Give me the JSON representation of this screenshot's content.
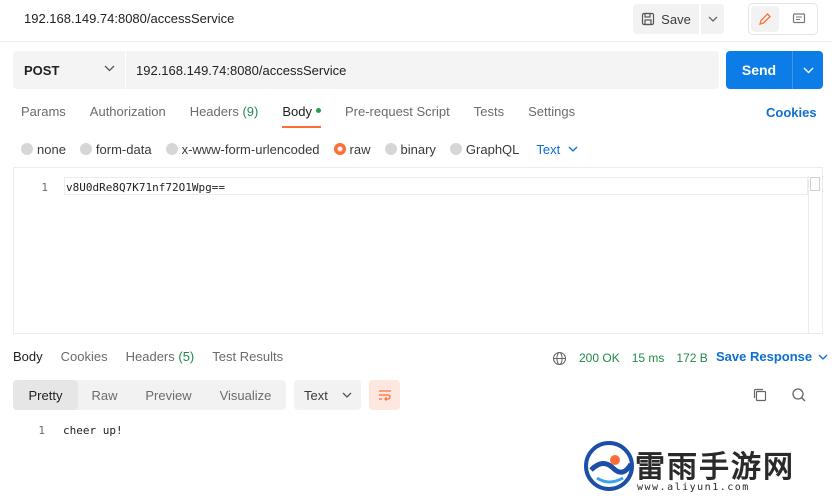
{
  "request": {
    "title": "192.168.149.74:8080/accessService",
    "save_label": "Save",
    "method": "POST",
    "url": "192.168.149.74:8080/accessService",
    "send_label": "Send"
  },
  "request_tabs": [
    {
      "label": "Params"
    },
    {
      "label": "Authorization"
    },
    {
      "label": "Headers",
      "count": "(9)"
    },
    {
      "label": "Body",
      "active": true
    },
    {
      "label": "Pre-request Script"
    },
    {
      "label": "Tests"
    },
    {
      "label": "Settings"
    }
  ],
  "cookies_label": "Cookies",
  "body_types": [
    {
      "label": "none"
    },
    {
      "label": "form-data"
    },
    {
      "label": "x-www-form-urlencoded"
    },
    {
      "label": "raw",
      "selected": true
    },
    {
      "label": "binary"
    },
    {
      "label": "GraphQL"
    }
  ],
  "body_format": "Text",
  "editor": {
    "line_number": "1",
    "content": "v8U0dRe8Q7K71nf72O1Wpg=="
  },
  "response_tabs": [
    {
      "label": "Body",
      "active": true
    },
    {
      "label": "Cookies"
    },
    {
      "label": "Headers",
      "count": "(5)"
    },
    {
      "label": "Test Results"
    }
  ],
  "response_status": {
    "status": "200 OK",
    "time": "15 ms",
    "size": "172 B"
  },
  "save_response_label": "Save Response",
  "view_modes": [
    {
      "label": "Pretty",
      "active": true
    },
    {
      "label": "Raw"
    },
    {
      "label": "Preview"
    },
    {
      "label": "Visualize"
    }
  ],
  "response_format": "Text",
  "response_body": {
    "line_number": "1",
    "content": "cheer up!"
  },
  "watermark": {
    "title": "雷雨手游网",
    "url": "www.aliyun1.com"
  },
  "colors": {
    "accent": "#ff6c37",
    "send": "#0c7ce6",
    "link": "#0c6fd4",
    "success": "#1e8a4a"
  }
}
